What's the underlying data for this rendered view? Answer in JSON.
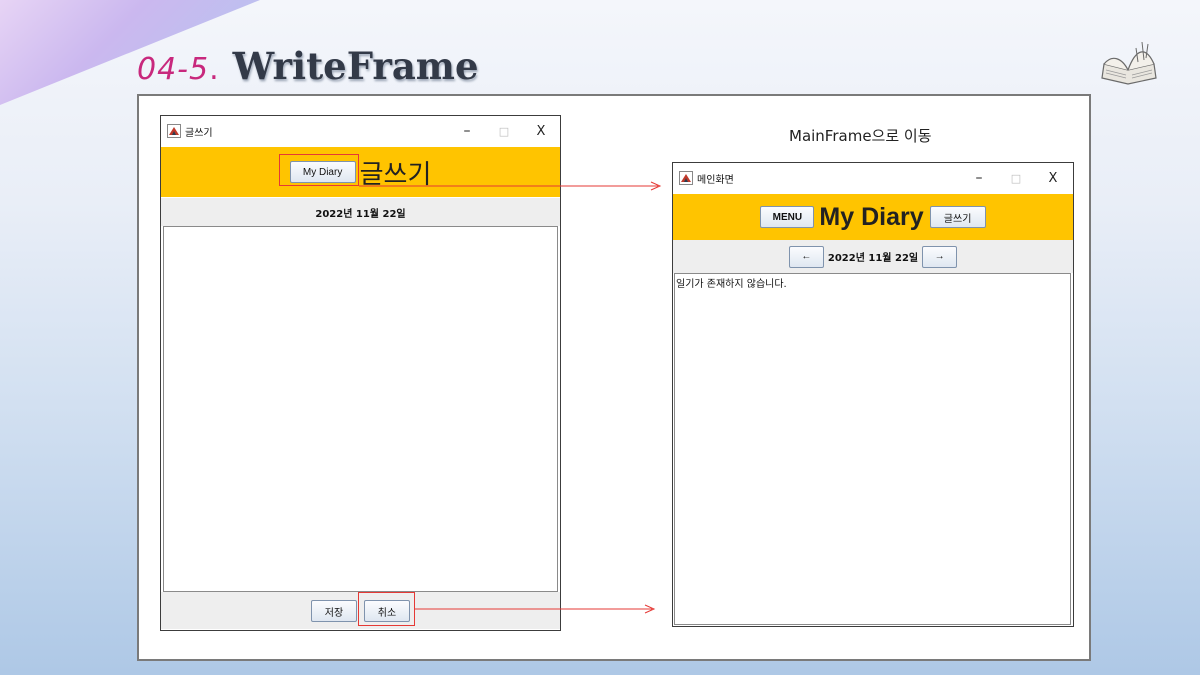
{
  "slide": {
    "section_number": "04-5",
    "section_dot": ".",
    "title": "WriteFrame",
    "caption": "MainFrame으로 이동"
  },
  "write_window": {
    "title": "글쓰기",
    "controls": {
      "minimize": "–",
      "maximize": "□",
      "close": "X"
    },
    "header": {
      "my_diary_button": "My Diary",
      "heading": "글쓰기"
    },
    "date": "2022년  11월  22일",
    "content": "",
    "footer": {
      "save_button": "저장",
      "cancel_button": "취소"
    }
  },
  "main_window": {
    "title": "메인화면",
    "controls": {
      "minimize": "–",
      "maximize": "□",
      "close": "X"
    },
    "header": {
      "menu_button": "MENU",
      "heading": "My Diary",
      "write_button": "글쓰기"
    },
    "nav": {
      "prev_button": "←",
      "date": "2022년 11월 22일",
      "next_button": "→"
    },
    "content": "일기가 존재하지 않습니다."
  },
  "colors": {
    "header_yellow": "#ffc400",
    "highlight_red": "#e53935",
    "accent_pink": "#c8287d"
  },
  "icons": [
    "app-icon",
    "book-icon",
    "arrow-icon"
  ]
}
